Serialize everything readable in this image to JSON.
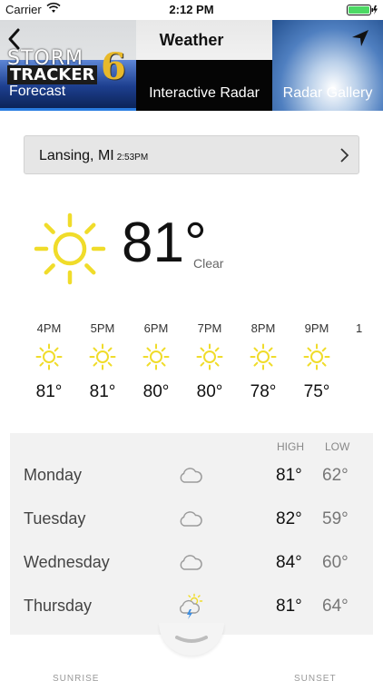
{
  "status_bar": {
    "carrier": "Carrier",
    "time": "2:12 PM"
  },
  "navbar": {
    "title": "Weather"
  },
  "tabs": [
    {
      "label": "Forecast"
    },
    {
      "label": "Interactive Radar"
    },
    {
      "label": "Radar Gallery"
    }
  ],
  "logo": {
    "line1": "STORM",
    "line2": "TRACKER",
    "number": "6"
  },
  "location": {
    "city": "Lansing, MI",
    "updated": "2:53PM"
  },
  "current": {
    "temp": "81°",
    "condition": "Clear",
    "icon": "sun-icon"
  },
  "hourly": [
    {
      "time": "4PM",
      "temp": "81°",
      "icon": "sun-icon"
    },
    {
      "time": "5PM",
      "temp": "81°",
      "icon": "sun-icon"
    },
    {
      "time": "6PM",
      "temp": "80°",
      "icon": "sun-icon"
    },
    {
      "time": "7PM",
      "temp": "80°",
      "icon": "sun-icon"
    },
    {
      "time": "8PM",
      "temp": "78°",
      "icon": "sun-icon"
    },
    {
      "time": "9PM",
      "temp": "75°",
      "icon": "sun-icon"
    },
    {
      "time": "1",
      "temp": "",
      "icon": ""
    }
  ],
  "forecast": {
    "high_label": "HIGH",
    "low_label": "LOW",
    "days": [
      {
        "day": "Monday",
        "high": "81°",
        "low": "62°",
        "icon": "cloud-icon"
      },
      {
        "day": "Tuesday",
        "high": "82°",
        "low": "59°",
        "icon": "cloud-icon"
      },
      {
        "day": "Wednesday",
        "high": "84°",
        "low": "60°",
        "icon": "cloud-icon"
      },
      {
        "day": "Thursday",
        "high": "81°",
        "low": "64°",
        "icon": "thunderstorm-icon"
      }
    ]
  },
  "bottom": {
    "sunrise": "SUNRISE",
    "sunset": "SUNSET"
  },
  "colors": {
    "sun": "#f0dc2a",
    "tab_active": "#2a7de1",
    "panel": "#f2f2f2"
  }
}
